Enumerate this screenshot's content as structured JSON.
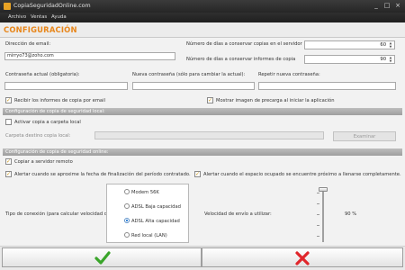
{
  "window": {
    "title": "CopiaSeguridadOnline.com",
    "controls": [
      "_",
      "□",
      "×"
    ]
  },
  "menu": {
    "items": [
      "Archivo",
      "Ventas",
      "Ayuda"
    ]
  },
  "header": {
    "title": "CONFIGURACIÓN"
  },
  "account": {
    "email_label": "Dirección de email:",
    "email_value": "mirryo73@zoho.com",
    "days_server_label": "Número de días a conservar copias en el servidor",
    "days_server_value": "60",
    "days_reports_label": "Número de días a conservar informes de copia",
    "days_reports_value": "90",
    "current_password_label": "Contraseña actual (obligatoria):",
    "new_password_label": "Nueva contraseña (sólo para cambiar la actual):",
    "repeat_password_label": "Repetir nueva contraseña:",
    "receive_reports_label": "Recibir los informes de copia por email",
    "receive_reports_checked": true,
    "show_preload_label": "Mostrar imagen de precarga al iniciar la aplicación",
    "show_preload_checked": true
  },
  "local_backup": {
    "section_title": "Configuración de copia de seguridad local:",
    "activate_label": "Activar copia a carpeta local",
    "activate_checked": false,
    "folder_label": "Carpeta destino copia local:",
    "browse_button": "Examinar"
  },
  "online_backup": {
    "section_title": "Configuración de copia de seguridad online:",
    "copy_remote_label": "Copiar a servidor remoto",
    "copy_remote_checked": true,
    "alert_expiry_label": "Alertar cuando se aproxime la fecha de finalización del período contratado.",
    "alert_expiry_checked": true,
    "alert_space_label": "Alertar cuando el espacio ocupado se encuentre próximo a llenarse completamente.",
    "alert_space_checked": true,
    "connection_label": "Tipo de conexión (para calcular velocidad de envío):",
    "connection_options": [
      "Modem 56K",
      "ADSL Baja capacidad",
      "ADSL Alta capacidad",
      "Red local (LAN)"
    ],
    "connection_selected": 2,
    "speed_label": "Velocidad de envío a utilizar:",
    "speed_value": "90 %",
    "speed_fraction": 0.9
  },
  "footer": {
    "ok_icon": "checkmark-icon",
    "cancel_icon": "cross-icon",
    "ok_color": "#3aa52a",
    "cancel_color": "#e0262b"
  },
  "colors": {
    "accent": "#e8861a",
    "section_bar": "#a8a8a8"
  }
}
